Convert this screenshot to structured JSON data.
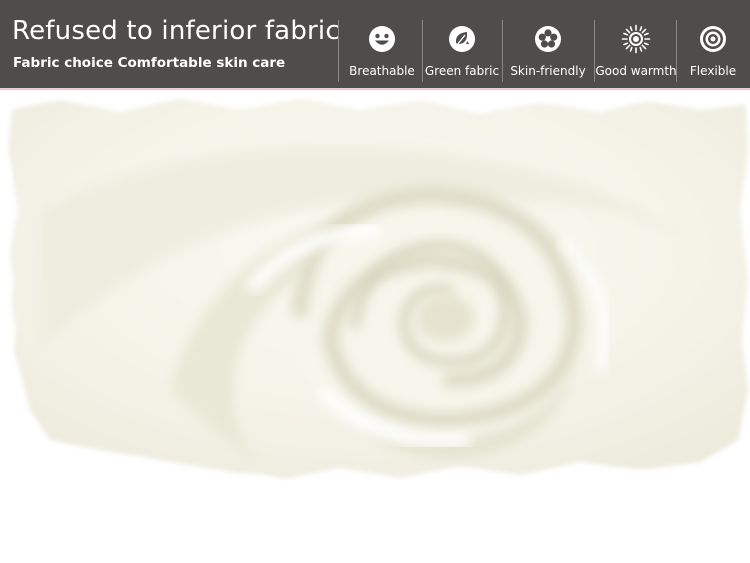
{
  "banner": {
    "title": "Refused to inferior fabric",
    "subtitle": "Fabric choice Comfortable skin care"
  },
  "features": [
    {
      "label": "Breathable",
      "icon": "smile-face-icon"
    },
    {
      "label": "Green fabric",
      "icon": "recycle-leaf-icon"
    },
    {
      "label": "Skin-friendly",
      "icon": "flower-icon"
    },
    {
      "label": "Good warmth",
      "icon": "sun-icon"
    },
    {
      "label": "Flexible",
      "icon": "concentric-circles-icon"
    }
  ],
  "colors": {
    "banner_bg": "#4f4d4c",
    "text": "#ffffff",
    "accent_line": "#efc7d5",
    "fabric": "#f7f6ee"
  }
}
